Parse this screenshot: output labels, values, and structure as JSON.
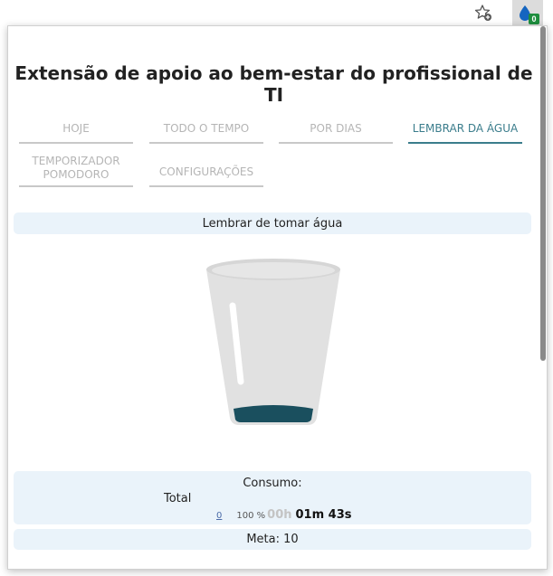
{
  "browser": {
    "extension_badge": "0"
  },
  "popup": {
    "title": "Extensão de apoio ao bem-estar do profissional de TI",
    "tabs": [
      {
        "label": "HOJE",
        "active": false
      },
      {
        "label": "TODO O TEMPO",
        "active": false
      },
      {
        "label": "POR DIAS",
        "active": false
      },
      {
        "label": "LEMBRAR DA ÁGUA",
        "active": true
      },
      {
        "label": "TEMPORIZADOR POMODORO",
        "active": false
      },
      {
        "label": "CONFIGURAÇÕES",
        "active": false
      }
    ],
    "reminder_label": "Lembrar de tomar água",
    "glass": {
      "fill_color": "#1a4f5e"
    },
    "stats": {
      "consumo_label": "Consumo:",
      "total_label": "Total",
      "count_link": "0",
      "percent": "100 %",
      "time_gray": "00h",
      "time_value": "01m 43s"
    },
    "meta_label": "Meta: 10"
  },
  "colors": {
    "accent": "#3b7d8c",
    "panel_bg": "#eaf3fa",
    "badge": "#1e8e3e"
  }
}
